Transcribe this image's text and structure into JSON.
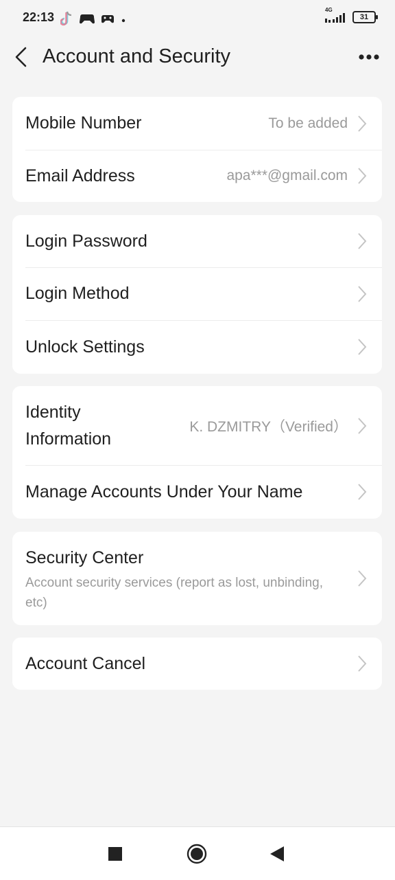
{
  "status_bar": {
    "time": "22:13",
    "network": "4G",
    "battery": "31",
    "left_icons": [
      "tiktok-icon",
      "gamepad-icon",
      "gamepad-small-icon",
      "dot-icon"
    ],
    "right_icons": [
      "signal-icon",
      "battery-icon"
    ]
  },
  "header": {
    "title": "Account and Security",
    "back_icon": "chevron-left-icon",
    "more_icon": "more-dots-icon"
  },
  "sections": {
    "contact": {
      "mobile_label": "Mobile Number",
      "mobile_value": "To be added",
      "email_label": "Email Address",
      "email_value": "apa***@gmail.com"
    },
    "login": {
      "password_label": "Login Password",
      "method_label": "Login Method",
      "unlock_label": "Unlock Settings"
    },
    "identity": {
      "identity_label_line1": "Identity",
      "identity_label_line2": "Information",
      "identity_value": "K. DZMITRY（Verified）",
      "manage_label": "Manage Accounts Under Your Name"
    },
    "security": {
      "center_label": "Security Center",
      "center_description": "Account security services (report as lost, unbinding, etc)"
    },
    "cancel": {
      "cancel_label": "Account Cancel"
    }
  },
  "nav_bar": {
    "icons": [
      "recents-square-icon",
      "home-circle-icon",
      "back-triangle-icon"
    ]
  },
  "colors": {
    "background": "#f4f4f4",
    "card": "#ffffff",
    "primary_text": "#1f1f1f",
    "secondary_text": "#9a9a9a",
    "chevron": "#c4c4c4"
  }
}
